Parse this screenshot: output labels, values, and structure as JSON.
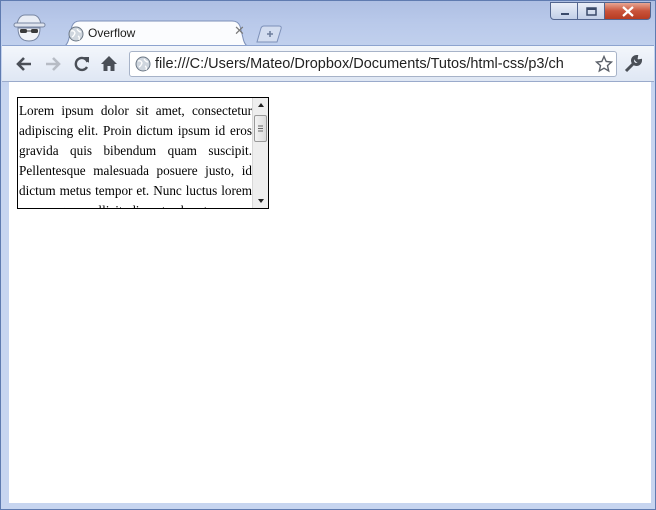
{
  "browser": {
    "tab": {
      "title": "Overflow"
    },
    "url": "file:///C:/Users/Mateo/Dropbox/Documents/Tutos/html-css/p3/ch"
  },
  "page": {
    "overflow_text": "Lorem ipsum dolor sit amet, consectetur adipiscing elit. Proin dictum ipsum id eros gravida quis bibendum quam suscipit. Pellentesque malesuada posuere justo, id dictum metus tempor et. Nunc luctus lorem nec augue sollicitudin ut pharetra nunc sodales. Sed ut eros ligula, at volutpat eros. Proin in diam at felis fermentum posuere."
  }
}
